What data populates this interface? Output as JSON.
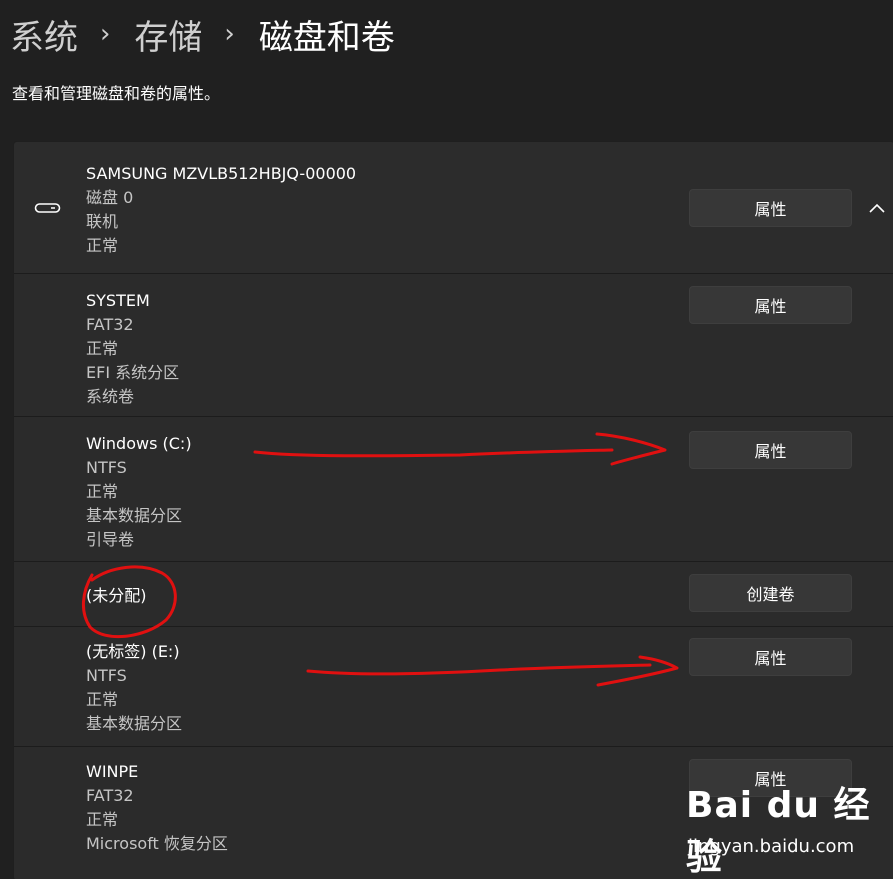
{
  "breadcrumb": [
    "系统",
    "存储",
    "磁盘和卷"
  ],
  "breadcrumb_separator": "›",
  "subtitle": "查看和管理磁盘和卷的属性。",
  "disk": {
    "name": "SAMSUNG MZVLB512HBJQ-00000",
    "number": "磁盘 0",
    "online": "联机",
    "status": "正常",
    "button": "属性"
  },
  "volumes": [
    {
      "name": "SYSTEM",
      "lines": [
        "FAT32",
        "正常",
        "EFI 系统分区",
        "系统卷"
      ],
      "button": "属性"
    },
    {
      "name": "Windows (C:)",
      "lines": [
        "NTFS",
        "正常",
        "基本数据分区",
        "引导卷"
      ],
      "button": "属性"
    },
    {
      "name": "(未分配)",
      "lines": [],
      "button": "创建卷"
    },
    {
      "name": "(无标签) (E:)",
      "lines": [
        "NTFS",
        "正常",
        "基本数据分区"
      ],
      "button": "属性"
    },
    {
      "name": "WINPE",
      "lines": [
        "FAT32",
        "正常",
        "Microsoft 恢复分区"
      ],
      "button": "属性"
    }
  ],
  "watermark": {
    "brand": "Bai du 经验",
    "url": "jingyan.baidu.com"
  },
  "colors": {
    "background": "#202020",
    "card": "#2b2b2b",
    "button": "#373737",
    "annotation": "#e01010"
  },
  "icons": {
    "drive": "drive-icon",
    "collapse": "chevron-up-icon"
  }
}
